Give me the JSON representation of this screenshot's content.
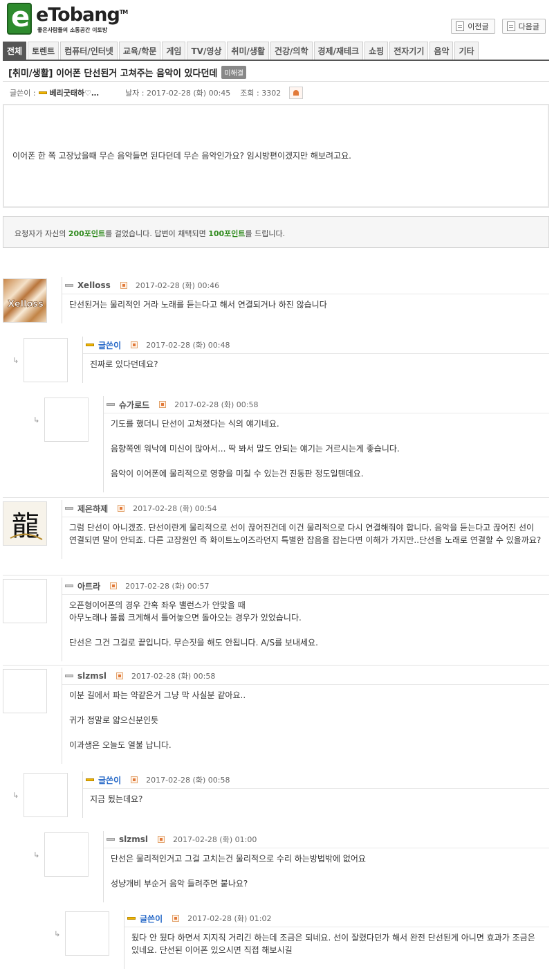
{
  "site": {
    "logo_letter": "e",
    "logo_name": "eTobang",
    "logo_tm": "TM",
    "tagline": "좋은사람들의 소통공간 이토방"
  },
  "nav": {
    "prev_label": "이전글",
    "next_label": "다음글"
  },
  "tabs": [
    "전체",
    "토렌트",
    "컴퓨터/인터넷",
    "교육/학문",
    "게임",
    "TV/영상",
    "취미/생활",
    "건강/의학",
    "경제/재테크",
    "쇼핑",
    "전자기기",
    "음악",
    "기타"
  ],
  "post": {
    "title": "[취미/생활] 이어폰 단선된거 고쳐주는 음악이 있다던데",
    "status": "미해결",
    "author_label": "글쓴이 :",
    "author": "베리굿태하♡…",
    "date_label": "날자 : 2017-02-28 (화) 00:45",
    "views_label": "조회 : 3302",
    "body": "이어폰 한 쪽 고장났을때 무슨 음악들면 된다던데 무슨 음악인가요? 임시방편이겠지만 해보려고요.",
    "point_pre": "요청자가 자신의 ",
    "point_a": "200포인트",
    "point_mid": "를 걸었습니다. 답변이 채택되면 ",
    "point_b": "100포인트",
    "point_post": "를 드립니다."
  },
  "comments": [
    {
      "name": "Xelloss",
      "date": "2017-02-28 (화) 00:46",
      "author": false,
      "depth": 0,
      "lines": [
        "단선된거는 물리적인 거라 노래를 듣는다고 해서 연결되거나 하진 않습니다"
      ]
    },
    {
      "name": "글쓴이",
      "date": "2017-02-28 (화) 00:48",
      "author": true,
      "depth": 1,
      "lines": [
        "진짜로 있다던데요?"
      ]
    },
    {
      "name": "슈가로드",
      "date": "2017-02-28 (화) 00:58",
      "author": false,
      "depth": 2,
      "lines": [
        "기도를 했더니 단선이 고쳐졌다는 식의 얘기네요.",
        "음향쪽엔 워낙에 미신이 많아서... 딱 봐서 말도 안되는 얘기는 거르시는게 좋습니다.",
        "음악이 이어폰에 물리적으로 영향을 미칠 수 있는건 진동판 정도일텐데요."
      ]
    },
    {
      "name": "제온하제",
      "date": "2017-02-28 (화) 00:54",
      "author": false,
      "depth": 0,
      "lines": [
        "그럼 단선이 아니겠죠. 단선이란게 물리적으로 선이 끊어진건데 이건 물리적으로 다시 연결해줘야 합니다. 음악을 듣는다고 끊어진 선이 연결되면 말이 안되죠. 다른 고장원인 즉 화이트노이즈라던지 특별한 잡음을 잡는다면 이해가 가지만..단선을 노래로 연결할 수 있을까요?"
      ]
    },
    {
      "name": "아트라",
      "date": "2017-02-28 (화) 00:57",
      "author": false,
      "depth": 0,
      "lines": [
        "오픈형이어폰의 경우 간혹 좌우 밸런스가 안맞을 때\n아무노래나 볼륨 크게해서 틀어놓으면 돌아오는 경우가 있었습니다.",
        "단선은 그건 그걸로 끝입니다. 무슨짓을 해도 안됩니다. A/S를 보내세요."
      ]
    },
    {
      "name": "slzmsl",
      "date": "2017-02-28 (화) 00:58",
      "author": false,
      "depth": 0,
      "lines": [
        "이분 길에서 파는 약같은거 그냥 막 사실분 같아요..",
        "귀가 정말로 얇으신분인듯",
        "이과생은 오늘도 열불 납니다."
      ]
    },
    {
      "name": "글쓴이",
      "date": "2017-02-28 (화) 00:58",
      "author": true,
      "depth": 1,
      "lines": [
        "지금 됬는데요?"
      ]
    },
    {
      "name": "slzmsl",
      "date": "2017-02-28 (화) 01:00",
      "author": false,
      "depth": 2,
      "lines": [
        "단선은 물리적인거고 그걸 고치는건 물리적으로 수리 하는방법밖에 없어요",
        "성냥개비 부순거 음악 들려주면 붙나요?"
      ]
    },
    {
      "name": "글쓴이",
      "date": "2017-02-28 (화) 01:02",
      "author": true,
      "depth": 3,
      "lines": [
        "됬다 안 됬다 하면서 지지직 거리긴 하는데 조금은 되네요. 선이 잘렸다던가 해서 완전 단선된게 아니면 효과가 조금은 있네요. 단선된 이어폰 있으시면 직접 해보시길"
      ]
    }
  ],
  "reply_arrow": "↳"
}
